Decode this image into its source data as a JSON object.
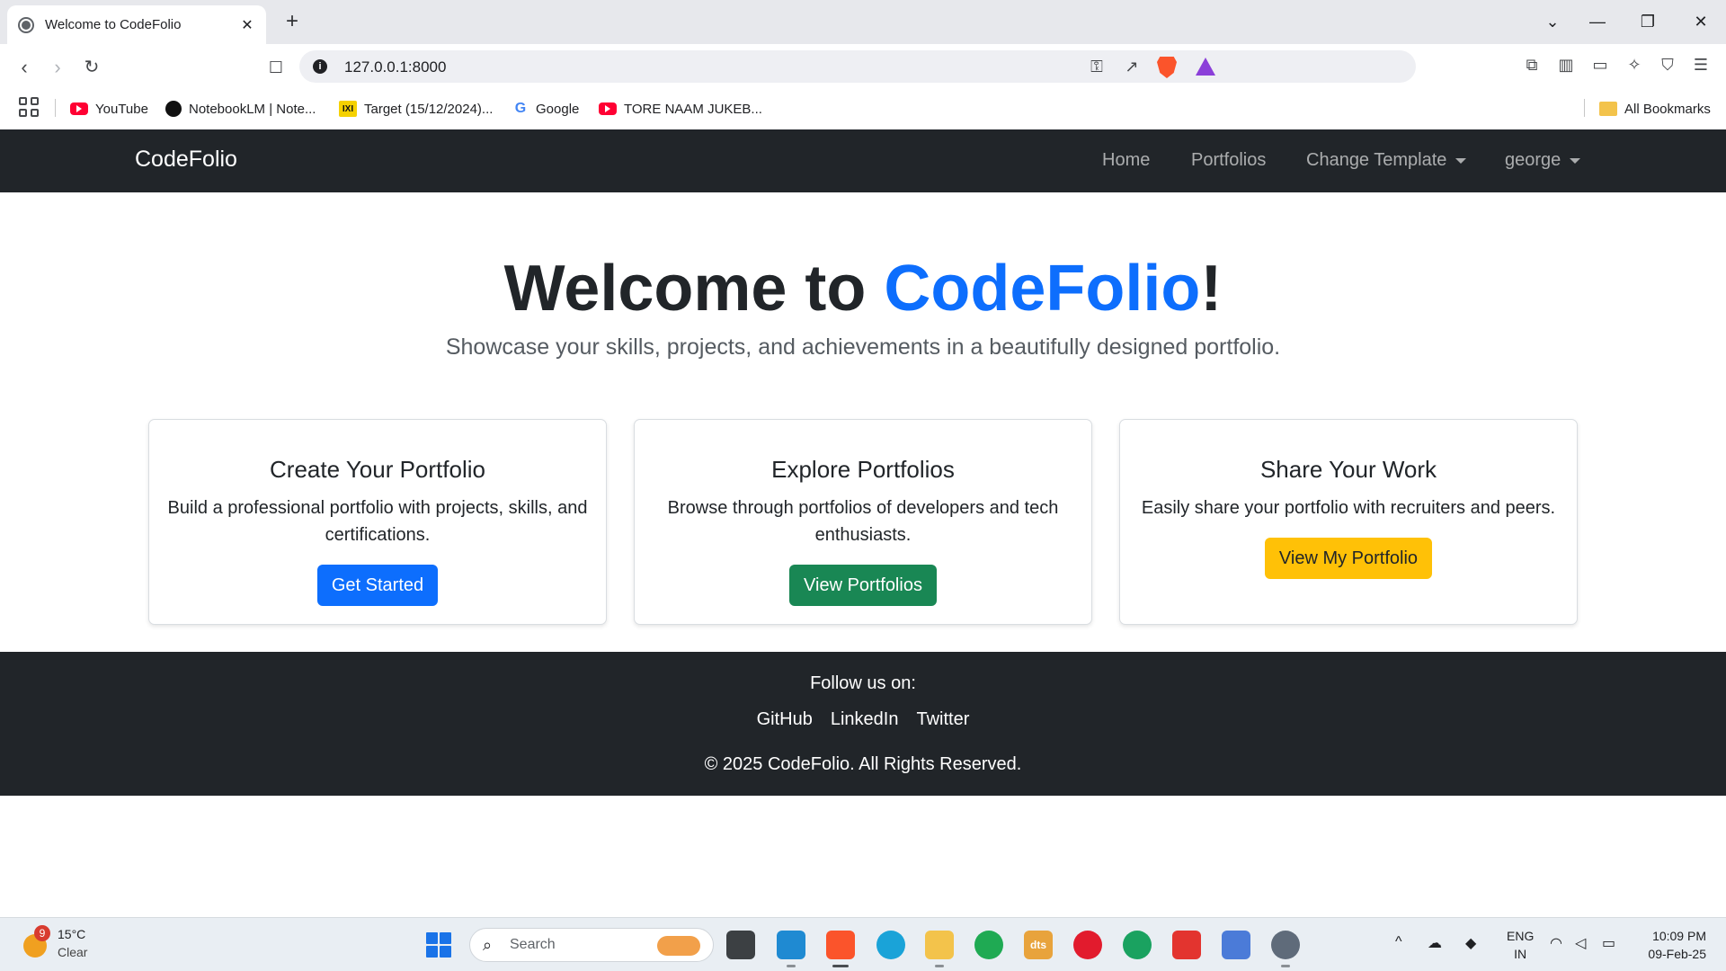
{
  "browser": {
    "tab": {
      "title": "Welcome to CodeFolio",
      "close": "✕"
    },
    "new_tab": "+",
    "window_controls": {
      "tab_search": "⌄",
      "minimize": "—",
      "restore": "❐",
      "close": "✕"
    },
    "nav": {
      "back": "‹",
      "forward": "›",
      "reload": "↻",
      "bookmark": "☐"
    },
    "url": "127.0.0.1:8000",
    "bookmarks": [
      {
        "label": "YouTube",
        "icon": "youtube-icon"
      },
      {
        "label": "NotebookLM | Note...",
        "icon": "notebooklm-icon"
      },
      {
        "label": "Target (15/12/2024)...",
        "icon": "target-icon",
        "icon_text": "IXI"
      },
      {
        "label": "Google",
        "icon": "google-icon",
        "icon_text": "G"
      },
      {
        "label": "TORE NAAM JUKEB...",
        "icon": "youtube-icon"
      }
    ],
    "all_bookmarks": "All Bookmarks"
  },
  "site": {
    "brand": "CodeFolio",
    "nav_links": [
      "Home",
      "Portfolios",
      "Change Template",
      "george"
    ],
    "hero": {
      "title_prefix": "Welcome to ",
      "title_accent": "CodeFolio",
      "title_suffix": "!",
      "subtitle": "Showcase your skills, projects, and achievements in a beautifully designed portfolio."
    },
    "cards": [
      {
        "title": "Create Your Portfolio",
        "text": "Build a professional portfolio with projects, skills, and certifications.",
        "button": "Get Started"
      },
      {
        "title": "Explore Portfolios",
        "text": "Browse through portfolios of developers and tech enthusiasts.",
        "button": "View Portfolios"
      },
      {
        "title": "Share Your Work",
        "text": "Easily share your portfolio with recruiters and peers.",
        "button": "View My Portfolio"
      }
    ],
    "footer": {
      "follow": "Follow us on:",
      "links": [
        "GitHub",
        "LinkedIn",
        "Twitter"
      ],
      "copyright": "© 2025 CodeFolio. All Rights Reserved."
    }
  },
  "taskbar": {
    "weather": {
      "badge": "9",
      "temp": "15°C",
      "condition": "Clear"
    },
    "search": {
      "icon": "⌕",
      "label": "Search"
    },
    "apps": [
      {
        "name": "task-view-icon",
        "color": "#3c4043"
      },
      {
        "name": "vscode-icon",
        "color": "#1f8ad2"
      },
      {
        "name": "brave-icon",
        "color": "#fb542b"
      },
      {
        "name": "edge-icon",
        "color": "#1aa3d8"
      },
      {
        "name": "file-explorer-icon",
        "color": "#f3c34b"
      },
      {
        "name": "whatsapp-icon",
        "color": "#1faa53"
      },
      {
        "name": "dts-icon",
        "color": "#e8a33c",
        "text": "dts"
      },
      {
        "name": "opera-icon",
        "color": "#e21b2d"
      },
      {
        "name": "chrome-icon",
        "color": "#1aa260"
      },
      {
        "name": "anydesk-icon",
        "color": "#e3342f"
      },
      {
        "name": "snipping-tool-icon",
        "color": "#4b7bd8"
      },
      {
        "name": "settings-icon",
        "color": "#5f6b7a"
      }
    ],
    "tray": {
      "chevron": "^",
      "lang_top": "ENG",
      "lang_bottom": "IN",
      "time": "10:09 PM",
      "date": "09-Feb-25"
    }
  }
}
